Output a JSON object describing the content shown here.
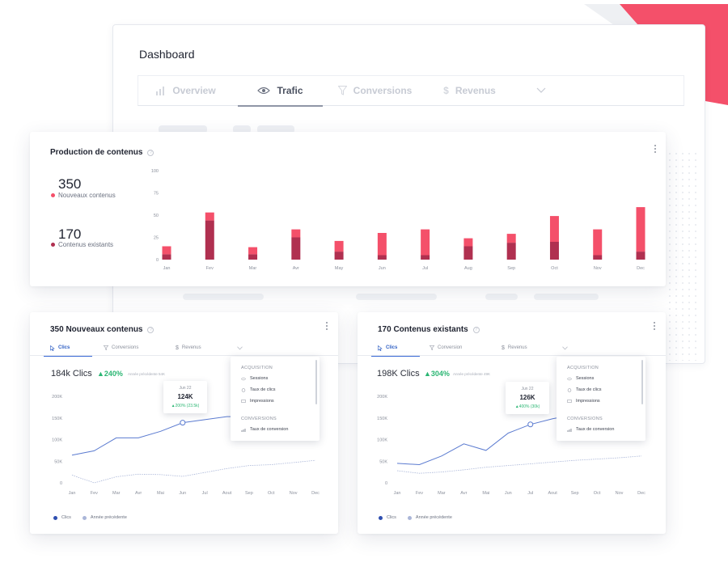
{
  "colors": {
    "accent_red": "#f4506a",
    "dark_red": "#b03050",
    "line_blue": "#5b7bd0",
    "prev_line": "#aab6d8",
    "delta_green": "#2bb673",
    "corner_grey": "#eeeff2"
  },
  "dashboard": {
    "title": "Dashboard",
    "tabs": [
      {
        "label": "Overview",
        "icon": "bar-chart-icon"
      },
      {
        "label": "Trafic",
        "icon": "eye-icon"
      },
      {
        "label": "Conversions",
        "icon": "funnel-icon"
      },
      {
        "label": "Revenus",
        "icon": "dollar-icon"
      }
    ],
    "active_tab": "Trafic"
  },
  "production": {
    "title": "Production de contenus",
    "kpis": [
      {
        "value": "350",
        "label": "Nouveaux contenus"
      },
      {
        "value": "170",
        "label": "Contenus existants"
      }
    ]
  },
  "chart_data": [
    {
      "type": "bar",
      "stacked": true,
      "categories": [
        "Jan",
        "Fev",
        "Mar",
        "Avr",
        "May",
        "Jun",
        "Jul",
        "Aug",
        "Sep",
        "Oct",
        "Nov",
        "Dec"
      ],
      "series": [
        {
          "name": "Contenus existants",
          "values": [
            6,
            44,
            6,
            25,
            9,
            5,
            5,
            15,
            19,
            20,
            5,
            9
          ]
        },
        {
          "name": "Nouveaux contenus",
          "values": [
            9,
            9,
            8,
            9,
            12,
            25,
            29,
            9,
            10,
            29,
            29,
            50
          ]
        }
      ],
      "yticks": [
        "0",
        "25",
        "50",
        "75",
        "100"
      ],
      "ylim": [
        0,
        100
      ],
      "grid": false
    },
    {
      "type": "line",
      "x": [
        "Jan",
        "Fev",
        "Mar",
        "Avr",
        "Mai",
        "Jun",
        "Jul",
        "Aout",
        "Sep",
        "Oct",
        "Nov",
        "Dec"
      ],
      "series": [
        {
          "name": "Clics",
          "values": [
            64,
            74,
            104,
            104,
            119,
            139,
            146,
            153,
            153,
            157,
            162,
            170
          ]
        },
        {
          "name": "Année précédente",
          "values": [
            18,
            0,
            14,
            20,
            19,
            15,
            24,
            33,
            40,
            42,
            47,
            52
          ]
        }
      ],
      "yticks": [
        "0",
        "50K",
        "100K",
        "150K",
        "200K"
      ],
      "ylim": [
        0,
        200
      ],
      "grid": false,
      "highlight": {
        "index": 5,
        "date": "Jun 22",
        "value": "124K",
        "delta": "▲200% (23.5k)"
      }
    },
    {
      "type": "line",
      "x": [
        "Jan",
        "Fev",
        "Mar",
        "Avr",
        "Mai",
        "Jun",
        "Jul",
        "Aout",
        "Sep",
        "Oct",
        "Nov",
        "Dec"
      ],
      "series": [
        {
          "name": "Clics",
          "values": [
            45,
            42,
            62,
            90,
            75,
            115,
            135,
            148,
            158,
            165,
            172,
            180
          ]
        },
        {
          "name": "Année précédente",
          "values": [
            28,
            22,
            25,
            30,
            36,
            40,
            44,
            48,
            52,
            55,
            58,
            62
          ]
        }
      ],
      "yticks": [
        "0",
        "50K",
        "100K",
        "150K",
        "200K"
      ],
      "ylim": [
        0,
        200
      ],
      "grid": false,
      "highlight": {
        "index": 6,
        "date": "Jun 22",
        "value": "126K",
        "delta": "▲400% (30k)"
      }
    }
  ],
  "cards": [
    {
      "title": "350 Nouveaux contenus",
      "tabs": [
        "Clics",
        "Conversions",
        "Revenus"
      ],
      "metric": "184k Clics",
      "delta": "▲240%",
      "prev": "Année précédente 54K",
      "dropdown": {
        "heading1": "ACQUISITION",
        "items1": [
          "Sessions",
          "Taux de clics",
          "Impressions"
        ],
        "heading2": "CONVERSIONS",
        "items2": [
          "Taux de conversion"
        ]
      },
      "legend": [
        "Clics",
        "Année précédente"
      ]
    },
    {
      "title": "170 Contenus existants",
      "tabs": [
        "Clics",
        "Conversion",
        "Revenus"
      ],
      "metric": "198K Clics",
      "delta": "▲304%",
      "prev": "Année précédente 49K",
      "dropdown": {
        "heading1": "ACQUISITION",
        "items1": [
          "Sessions",
          "Taux de clics",
          "Impressions"
        ],
        "heading2": "CONVERSIONS",
        "items2": [
          "Taux de conversion"
        ]
      },
      "legend": [
        "Clics",
        "Année précédente"
      ]
    }
  ]
}
